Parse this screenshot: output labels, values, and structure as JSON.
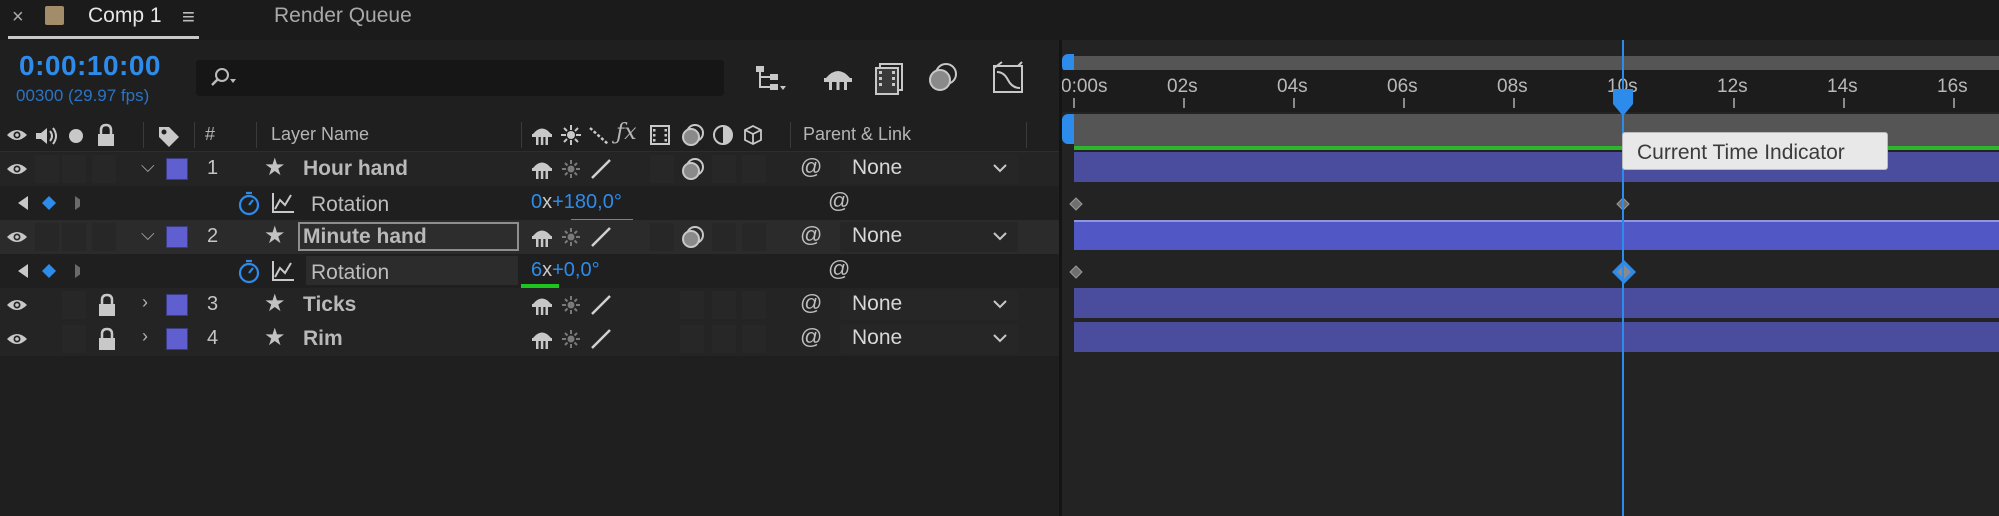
{
  "tabs": {
    "close": "×",
    "comp_label": "Comp 1",
    "menu": "≡",
    "render_queue": "Render Queue"
  },
  "time": {
    "timecode": "0:00:10:00",
    "frames_fps": "00300 (29.97 fps)"
  },
  "columns": {
    "hash": "#",
    "layer_name": "Layer Name",
    "parent_link": "Parent & Link"
  },
  "layers": [
    {
      "num": "1",
      "name": "Hour hand",
      "parent": "None",
      "expanded": true,
      "locked": false
    },
    {
      "num": "2",
      "name": "Minute hand",
      "parent": "None",
      "expanded": true,
      "locked": false,
      "selected": true
    },
    {
      "num": "3",
      "name": "Ticks",
      "parent": "None",
      "expanded": false,
      "locked": true
    },
    {
      "num": "4",
      "name": "Rim",
      "parent": "None",
      "expanded": false,
      "locked": true
    }
  ],
  "props": [
    {
      "name": "Rotation",
      "revolutions": "0",
      "x": "x",
      "degrees": "+180,0°"
    },
    {
      "name": "Rotation",
      "revolutions": "6",
      "x": "x",
      "degrees": "+0,0°"
    }
  ],
  "ruler_ticks": [
    "0:00s",
    "02s",
    "04s",
    "06s",
    "08s",
    "10s",
    "12s",
    "14s",
    "16s"
  ],
  "tooltip": "Current Time Indicator",
  "colors": {
    "accent_blue": "#2d8ceb",
    "layer_label": "#5f5fd0",
    "layer_bar": "#4a4c9e",
    "green": "#1ec51e"
  }
}
